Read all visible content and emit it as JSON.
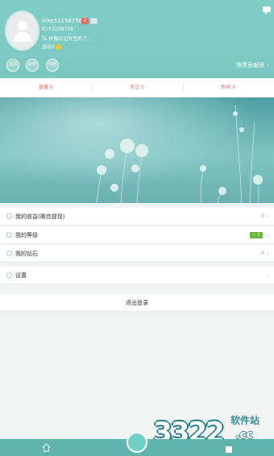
{
  "profile": {
    "name": "inke51258758",
    "level": "2",
    "id_text": "ID:51258758",
    "signature": "Ta 好像忘记写签名了...",
    "emoji_text": "送出0",
    "actions": [
      "送出",
      "收到",
      "动态"
    ],
    "contribution_label": "映票贡献榜",
    "contribution_arrow": "›"
  },
  "stats": [
    {
      "label": "直播 0"
    },
    {
      "label": "关注 0"
    },
    {
      "label": "粉丝 0"
    }
  ],
  "menu": {
    "income": {
      "label": "我的收益(微信提现)",
      "value": "0",
      "arrow": "›"
    },
    "level": {
      "label": "我的等级",
      "badge": "☆ 1",
      "arrow": "›"
    },
    "diamond": {
      "label": "我的钻石",
      "value": "0",
      "arrow": "›"
    },
    "settings": {
      "label": "设置",
      "arrow": "›"
    }
  },
  "logout_label": "退出登录",
  "watermark": {
    "number": "3322",
    "site": "软件站",
    "domain": ".cc"
  },
  "colors": {
    "header": "#7fcdc6",
    "accent_red": "#e06a6a",
    "tabbar": "#5fb5ae",
    "level_green": "#6cb33a"
  },
  "icons": {
    "home": "home-icon",
    "chat": "chat-icon",
    "avatar": "user-avatar-icon"
  }
}
